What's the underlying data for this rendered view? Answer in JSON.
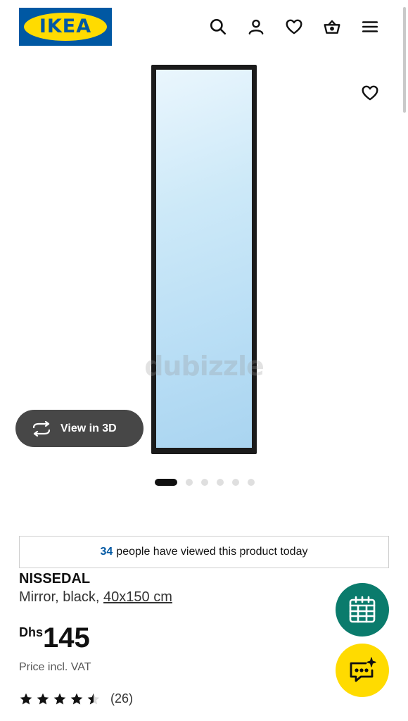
{
  "header": {
    "logo_text": "IKEA",
    "icons": [
      "search-icon",
      "user-icon",
      "heart-icon",
      "basket-icon",
      "menu-icon"
    ]
  },
  "gallery": {
    "watermark_text": "dubizzle",
    "view3d_label": "View in 3D",
    "slide_count": 6,
    "active_slide": 1
  },
  "social_proof": {
    "count": "34",
    "text": "people have viewed this product today"
  },
  "product": {
    "name": "NISSEDAL",
    "description": "Mirror, black, ",
    "size": "40x150 cm",
    "currency": "Dhs",
    "price": "145",
    "vat_note": "Price incl. VAT",
    "rating_value": 4.5,
    "rating_count": "(26)"
  },
  "colors": {
    "brand_blue": "#0058a3",
    "brand_yellow": "#ffdb00",
    "fab_green": "#0a7b6c"
  }
}
